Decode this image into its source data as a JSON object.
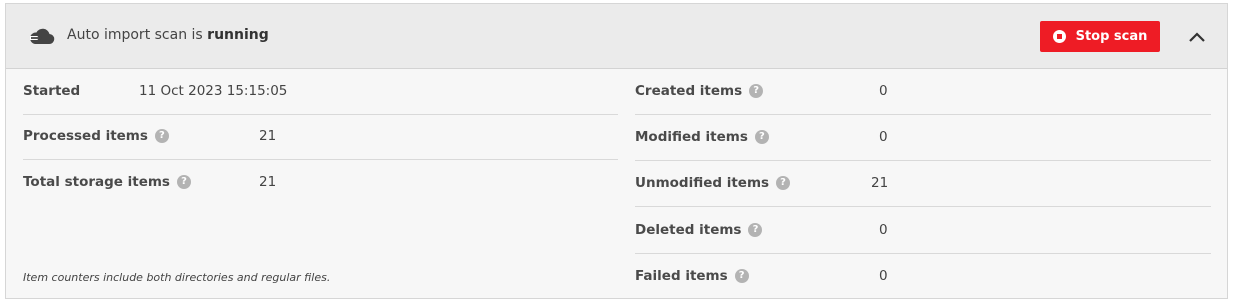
{
  "header": {
    "title_prefix": "Auto import scan is ",
    "status": "running",
    "stop_button_label": "Stop scan",
    "icon": "cloud-import-icon",
    "collapse_icon": "chevron-up-icon"
  },
  "colors": {
    "accent": "#ee1c25",
    "header_bg": "#ebebeb",
    "panel_bg": "#f7f7f7",
    "help_icon": "#b3b3b3"
  },
  "left_stats": [
    {
      "label": "Started",
      "value": "11 Oct 2023 15:15:05",
      "help": false
    },
    {
      "label": "Processed items",
      "value": "21",
      "help": true
    },
    {
      "label": "Total storage items",
      "value": "21",
      "help": true
    }
  ],
  "right_stats": [
    {
      "label": "Created items",
      "value": "0",
      "help": true
    },
    {
      "label": "Modified items",
      "value": "0",
      "help": true
    },
    {
      "label": "Unmodified items",
      "value": "21",
      "help": true
    },
    {
      "label": "Deleted items",
      "value": "0",
      "help": true
    },
    {
      "label": "Failed items",
      "value": "0",
      "help": true
    }
  ],
  "help_glyph": "?",
  "footnote": "Item counters include both directories and regular files."
}
